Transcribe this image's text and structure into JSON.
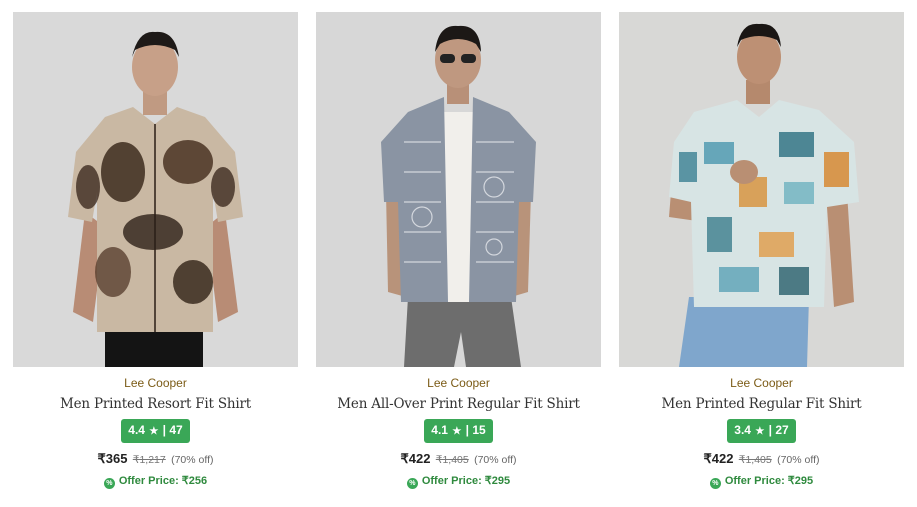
{
  "products": [
    {
      "brand": "Lee Cooper",
      "title": "Men Printed Resort Fit Shirt",
      "rating": "4.4",
      "rating_sep": "|",
      "reviews": "47",
      "price": "₹365",
      "mrp": "₹1,217",
      "discount": "(70% off)",
      "offer": "Offer Price: ₹256",
      "image": "model-brown-tie-dye-shirt"
    },
    {
      "brand": "Lee Cooper",
      "title": "Men All-Over Print Regular Fit Shirt",
      "rating": "4.1",
      "rating_sep": "|",
      "reviews": "15",
      "price": "₹422",
      "mrp": "₹1,405",
      "discount": "(70% off)",
      "offer": "Offer Price: ₹295",
      "image": "model-grey-print-shirt"
    },
    {
      "brand": "Lee Cooper",
      "title": "Men Printed Regular Fit Shirt",
      "rating": "3.4",
      "rating_sep": "|",
      "reviews": "27",
      "price": "₹422",
      "mrp": "₹1,405",
      "discount": "(70% off)",
      "offer": "Offer Price: ₹295",
      "image": "model-teal-patchwork-shirt"
    }
  ],
  "icons": {
    "star": "star-icon",
    "offer": "offer-tag-icon"
  },
  "colors": {
    "brand_text": "#7b5b16",
    "rating_badge": "#3aa757",
    "offer_text": "#2f8a3e"
  }
}
